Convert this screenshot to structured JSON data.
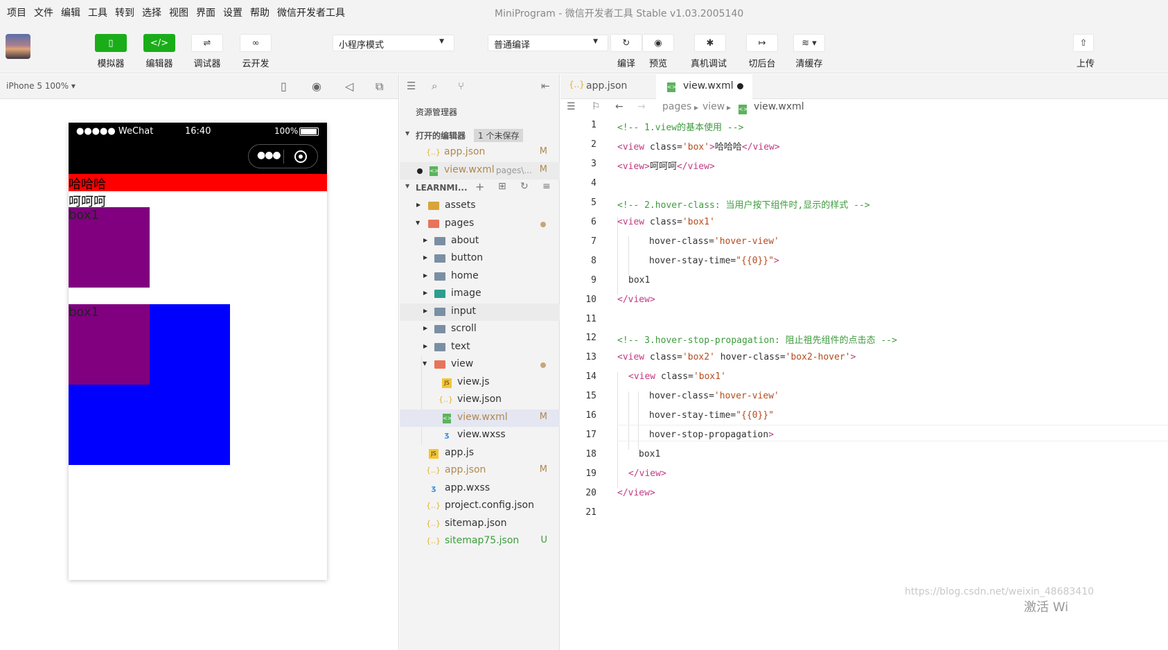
{
  "menu": [
    "项目",
    "文件",
    "编辑",
    "工具",
    "转到",
    "选择",
    "视图",
    "界面",
    "设置",
    "帮助",
    "微信开发者工具"
  ],
  "window_title": "MiniProgram - 微信开发者工具 Stable v1.03.2005140",
  "toolbar": {
    "simulator": "模拟器",
    "editor": "编辑器",
    "debugger": "调试器",
    "cloud": "云开发",
    "mode_select": "小程序模式",
    "compile_select": "普通编译",
    "compile": "编译",
    "preview": "预览",
    "real_debug": "真机调试",
    "background": "切后台",
    "clear_cache": "清缓存",
    "upload": "上传",
    "editor_code_glyph": "</>"
  },
  "simulator": {
    "device": "iPhone 5 100% ▾",
    "status_signal": "●●●●● WeChat",
    "status_time": "16:40",
    "status_battery": "100%",
    "text1": "哈哈哈",
    "text2": "呵呵呵",
    "box_a_label": "box1",
    "box_b_label": "box1"
  },
  "explorer": {
    "title": "资源管理器",
    "open_editors": "打开的编辑器",
    "unsaved": "1 个未保存",
    "open_files": [
      {
        "name": "app.json",
        "path": "",
        "badge": "M"
      },
      {
        "name": "view.wxml",
        "path": "pages\\...",
        "badge": "M"
      }
    ],
    "project": "LEARNMI...",
    "tree": [
      {
        "name": "assets",
        "badge": ""
      },
      {
        "name": "pages",
        "badge": ""
      },
      {
        "name": "about",
        "badge": ""
      },
      {
        "name": "button",
        "badge": ""
      },
      {
        "name": "home",
        "badge": ""
      },
      {
        "name": "image",
        "badge": ""
      },
      {
        "name": "input",
        "badge": ""
      },
      {
        "name": "scroll",
        "badge": ""
      },
      {
        "name": "text",
        "badge": ""
      },
      {
        "name": "view",
        "badge": ""
      },
      {
        "name": "view.js",
        "badge": ""
      },
      {
        "name": "view.json",
        "badge": ""
      },
      {
        "name": "view.wxml",
        "badge": "M"
      },
      {
        "name": "view.wxss",
        "badge": ""
      },
      {
        "name": "app.js",
        "badge": ""
      },
      {
        "name": "app.json",
        "badge": "M"
      },
      {
        "name": "app.wxss",
        "badge": ""
      },
      {
        "name": "project.config.json",
        "badge": ""
      },
      {
        "name": "sitemap.json",
        "badge": ""
      },
      {
        "name": "sitemap75.json",
        "badge": "U"
      }
    ]
  },
  "editor": {
    "tabs": [
      {
        "label": "app.json"
      },
      {
        "label": "view.wxml"
      }
    ],
    "breadcrumb": [
      "pages",
      "view",
      "view.wxml"
    ],
    "lines": [
      "<!-- 1.view的基本使用 -->",
      "<view class='box'>哈哈哈</view>",
      "<view>呵呵呵</view>",
      "",
      "<!-- 2.hover-class: 当用户按下组件时,显示的样式 -->",
      "<view class='box1'",
      "      hover-class='hover-view'",
      "      hover-stay-time=\"{{0}}\">",
      "  box1",
      "</view>",
      "",
      "<!-- 3.hover-stop-propagation: 阻止祖先组件的点击态 -->",
      "<view class='box2' hover-class='box2-hover'>",
      "  <view class='box1'",
      "        hover-class='hover-view'",
      "        hover-stay-time=\"{{0}}\"",
      "        hover-stop-propagation>",
      "    box1",
      "  </view>",
      "</view>",
      ""
    ]
  },
  "watermark": "https://blog.csdn.net/weixin_48683410",
  "activate": "激活 Wi",
  "colors": {
    "red": "#ff0000",
    "purple": "#800080",
    "blue": "#0000ff",
    "green": "#1aad19"
  }
}
